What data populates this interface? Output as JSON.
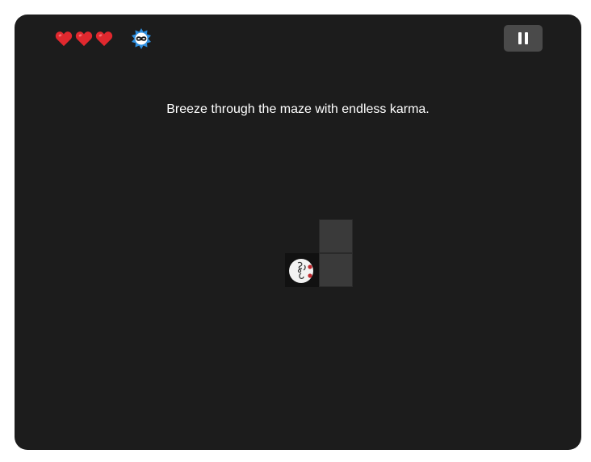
{
  "hud": {
    "lives": 3,
    "hearts": [
      {
        "icon": "heart-icon",
        "color": "#e0282e"
      },
      {
        "icon": "heart-icon",
        "color": "#e0282e"
      },
      {
        "icon": "heart-icon",
        "color": "#e0282e"
      }
    ],
    "karma_icon": "infinity-karma-icon",
    "karma_color": "#2e8fe0",
    "pause_icon": "pause-icon"
  },
  "hint": {
    "text": "Breeze through the maze with endless karma."
  },
  "maze": {
    "tile_color": "#3a3a3a",
    "background_color": "#1c1c1c",
    "player_icon": "player-face-icon"
  }
}
